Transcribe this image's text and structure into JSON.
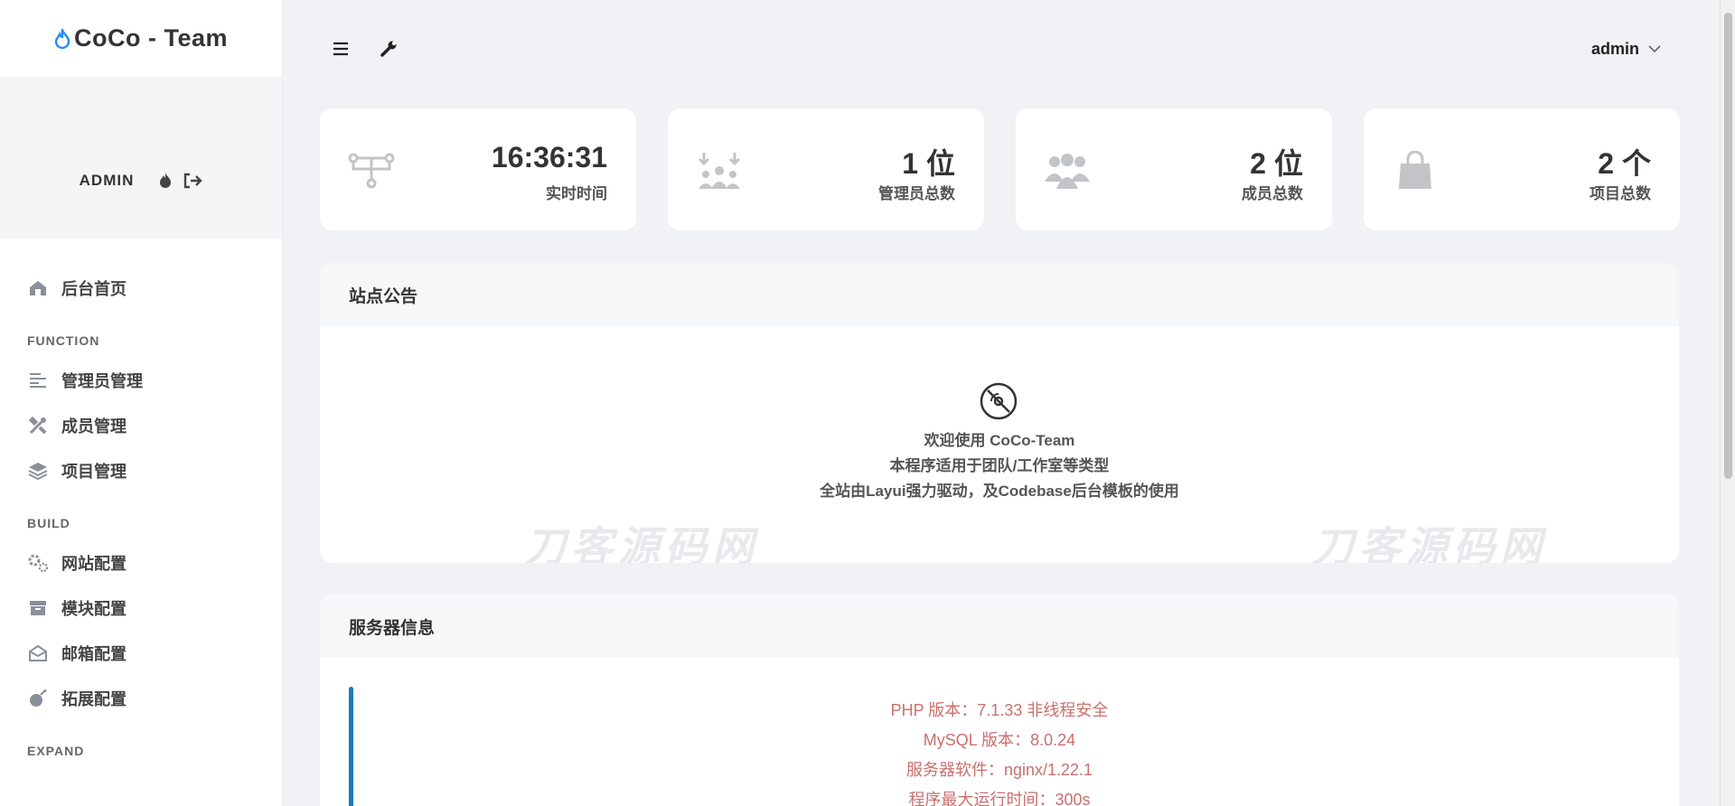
{
  "brand": {
    "title": "CoCo - Team",
    "icon": "flame-icon",
    "color": "#1e90ff"
  },
  "profile": {
    "name": "ADMIN"
  },
  "sidebar": {
    "home": {
      "label": "后台首页",
      "icon": "home-icon"
    },
    "sections": [
      {
        "label": "FUNCTION",
        "items": [
          {
            "label": "管理员管理",
            "icon": "list-icon"
          },
          {
            "label": "成员管理",
            "icon": "tools-icon"
          },
          {
            "label": "项目管理",
            "icon": "layers-icon"
          }
        ]
      },
      {
        "label": "BUILD",
        "items": [
          {
            "label": "网站配置",
            "icon": "cogs-icon"
          },
          {
            "label": "模块配置",
            "icon": "box-icon"
          },
          {
            "label": "邮箱配置",
            "icon": "envelope-icon"
          },
          {
            "label": "拓展配置",
            "icon": "bomb-icon"
          }
        ]
      },
      {
        "label": "EXPAND",
        "items": []
      }
    ]
  },
  "topbar": {
    "user": "admin"
  },
  "stats": [
    {
      "value": "16:36:31",
      "label": "实时时间",
      "icon": "network-icon"
    },
    {
      "value": "1 位",
      "label": "管理员总数",
      "icon": "admin-group-icon"
    },
    {
      "value": "2 位",
      "label": "成员总数",
      "icon": "users-icon"
    },
    {
      "value": "2 个",
      "label": "项目总数",
      "icon": "shopping-bag-icon"
    }
  ],
  "announcement": {
    "title": "站点公告",
    "lines": [
      "欢迎使用 CoCo-Team",
      "本程序适用于团队/工作室等类型",
      "全站由Layui强力驱动，及Codebase后台模板的使用"
    ],
    "watermark": "刀客源码网"
  },
  "server": {
    "title": "服务器信息",
    "lines": [
      "PHP 版本：7.1.33 非线程安全",
      "MySQL 版本：8.0.24",
      "服务器软件：nginx/1.22.1",
      "程序最大运行时间：300s"
    ]
  }
}
